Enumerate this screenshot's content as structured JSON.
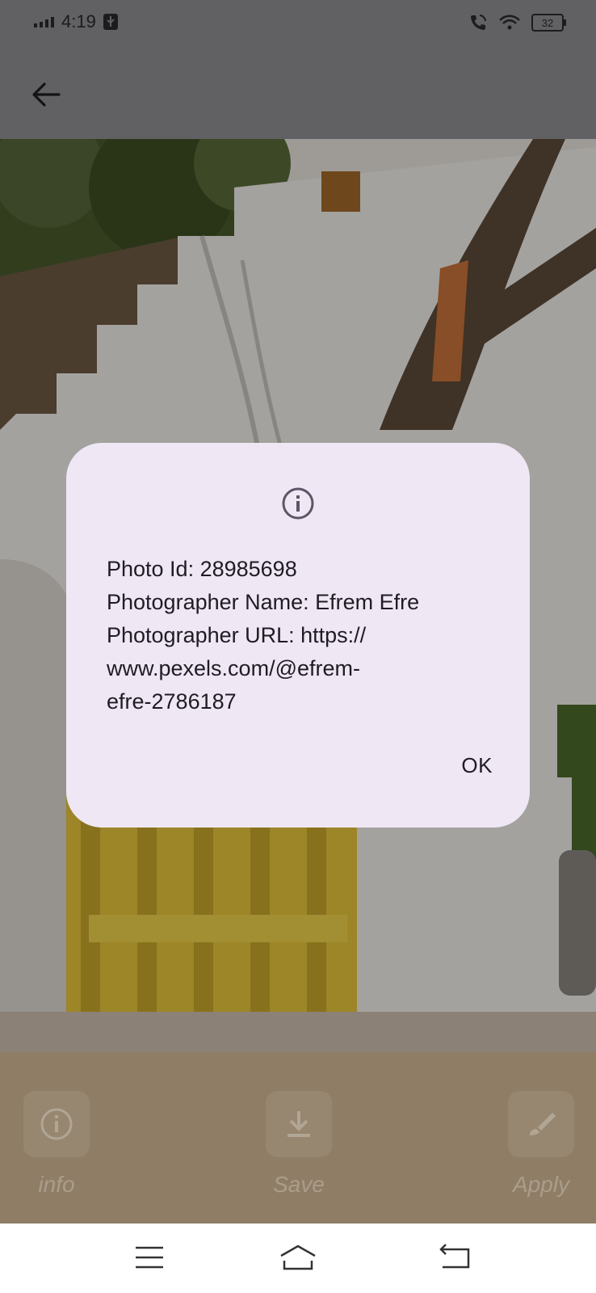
{
  "status_bar": {
    "time": "4:19",
    "battery": "32"
  },
  "dialog": {
    "lines": [
      "Photo Id: 28985698",
      "Photographer Name: Efrem  Efre",
      "Photographer URL: https://",
      "www.pexels.com/@efrem-",
      "efre-2786187"
    ],
    "ok_label": "OK"
  },
  "actions": {
    "info_label": "info",
    "save_label": "Save",
    "apply_label": "Apply"
  },
  "colors": {
    "dialog_bg": "#efe7f4",
    "text": "#1f1c24",
    "gate_yellow": "#e6c63a",
    "icon": "#5d5567"
  }
}
